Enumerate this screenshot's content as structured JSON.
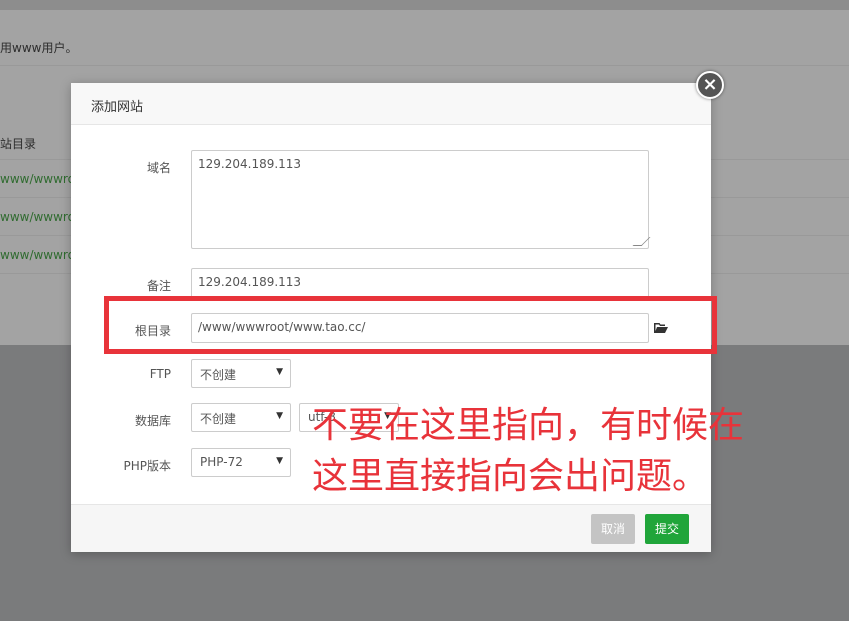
{
  "background": {
    "note_text": "用www用户。",
    "column_header": "站目录",
    "rows": [
      "www/wwwroo",
      "www/wwwroo",
      "www/wwwroo"
    ]
  },
  "modal": {
    "title": "添加网站",
    "close_label": "×",
    "fields": {
      "domain_label": "域名",
      "domain_value": "129.204.189.113",
      "remark_label": "备注",
      "remark_value": "129.204.189.113",
      "root_label": "根目录",
      "root_value": "/www/wwwroot/www.tao.cc/",
      "ftp_label": "FTP",
      "ftp_selected": "不创建",
      "db_label": "数据库",
      "db_selected": "不创建",
      "db_charset": "utf-8",
      "php_label": "PHP版本",
      "php_selected": "PHP-72"
    },
    "buttons": {
      "cancel": "取消",
      "submit": "提交"
    }
  },
  "annotation": {
    "line1": "不要在这里指向，有时候在",
    "line2": "这里直接指向会出问题。",
    "color": "#e8333a"
  },
  "icons": {
    "folder": "folder-open-icon",
    "close": "close-icon",
    "dropdown": "caret-down-icon"
  }
}
